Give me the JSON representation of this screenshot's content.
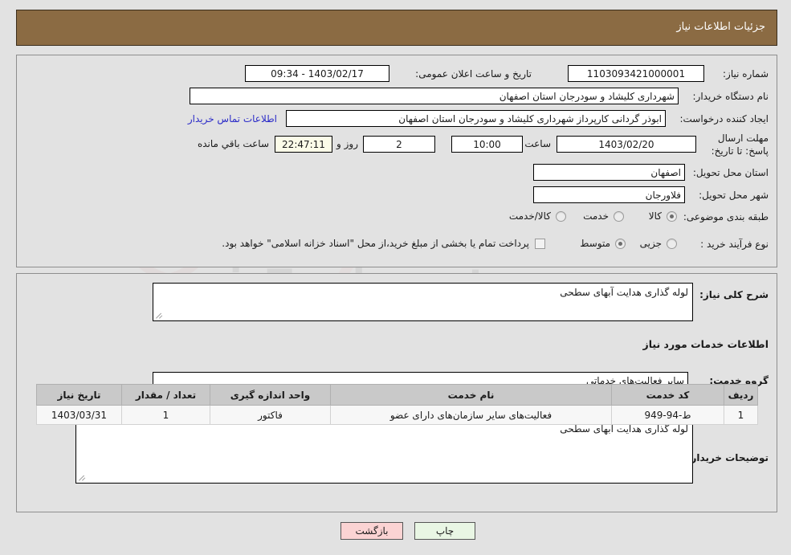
{
  "header": {
    "title": "جزئیات اطلاعات نیاز"
  },
  "top_section": {
    "need_number": {
      "label": "شماره نیاز:",
      "value": "1103093421000001"
    },
    "announce_datetime": {
      "label": "تاریخ و ساعت اعلان عمومی:",
      "value": "1403/02/17 - 09:34"
    },
    "buyer_org": {
      "label": "نام دستگاه خریدار:",
      "value": "شهرداری کلیشاد و سودرجان استان اصفهان"
    },
    "request_creator": {
      "label": "ایجاد کننده درخواست:",
      "value": "ابوذر گردانی کارپرداز شهرداری کلیشاد و سودرجان استان اصفهان"
    },
    "buyer_contact_link": "اطلاعات تماس خریدار",
    "deadline": {
      "label": "مهلت ارسال پاسخ: تا تاریخ:",
      "date": "1403/02/20",
      "time_label": "ساعت",
      "time": "10:00",
      "days": "2",
      "days_label": "روز و",
      "timer": "22:47:11",
      "timer_label": "ساعت باقي مانده"
    },
    "delivery_province": {
      "label": "استان محل تحویل:",
      "value": "اصفهان"
    },
    "delivery_city": {
      "label": "شهر محل تحویل:",
      "value": "فلاورجان"
    },
    "subject_classification": {
      "label": "طبقه بندی موضوعی:",
      "options": [
        {
          "label": "کالا",
          "selected": false
        },
        {
          "label": "خدمت",
          "selected": true
        },
        {
          "label": "کالا/خدمت",
          "selected": false
        }
      ]
    },
    "purchase_process": {
      "label": "نوع فرآیند خرید :",
      "options": [
        {
          "label": "جزیی",
          "selected": false
        },
        {
          "label": "متوسط",
          "selected": true
        }
      ],
      "treasury_checkbox": {
        "checked": false,
        "label": "پرداخت تمام یا بخشی از مبلغ خرید،از محل \"اسناد خزانه اسلامی\" خواهد بود."
      }
    }
  },
  "middle_section": {
    "general_desc": {
      "label": "شرح کلی نیاز:",
      "value": "لوله گذاری هدایت آبهای سطحی"
    },
    "services_heading": "اطلاعات خدمات مورد نیاز",
    "service_group": {
      "label": "گروه خدمت:",
      "value": "سایر فعالیت‌های خدماتی"
    },
    "table": {
      "columns": [
        "ردیف",
        "کد خدمت",
        "نام خدمت",
        "واحد اندازه گیری",
        "تعداد / مقدار",
        "تاریخ نیاز"
      ],
      "rows": [
        [
          "1",
          "ط-94-949",
          "فعالیت‌های سایر سازمان‌های دارای عضو",
          "فاکتور",
          "1",
          "1403/03/31"
        ]
      ]
    },
    "buyer_notes": {
      "label": "توضیحات خریدار:",
      "value": "لوله گذاری هدایت آبهای سطحی"
    }
  },
  "footer": {
    "back_button": "بازگشت",
    "print_button": "چاپ"
  },
  "colors": {
    "header_bg": "#8b6b43",
    "page_bg": "#e2e2e2",
    "link": "#2b2bc8",
    "back_button_bg": "#fbd3d3",
    "print_button_bg": "#e9f6e4",
    "timer_bg": "#fbfbe8",
    "table_header_bg": "#c9c9c9"
  }
}
